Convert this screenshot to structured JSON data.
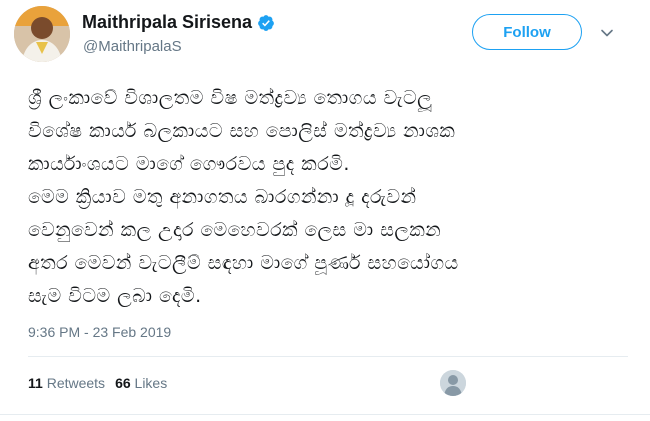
{
  "author": {
    "name": "Maithripala Sirisena",
    "handle": "@MaithripalaS",
    "verified_icon": "verified-badge-icon",
    "avatar_icon": "profile-photo"
  },
  "actions": {
    "follow_label": "Follow",
    "menu_icon": "chevron-down-icon"
  },
  "tweet": {
    "lines": [
      "ශ්‍රී ලංකාවේ විශාලතම විෂ මත්ද්‍රව්‍ය තොගය වැටලූ",
      "විශේෂ කාර්ය බලකායට සහ පොලිස් මත්ද්‍රව්‍ය නාශක",
      "කාර්යාංශයට මාගේ ගෞරවය පුද කරමි.",
      "මෙම ක්‍රියාව මතු අනාගතය බාරගන්නා දූ දරුවන්",
      "වෙනුවෙන් කල උදාර මෙහෙවරක් ලෙස මා සලකන",
      "අතර මෙවන් වැටලීම් සඳහා මාගේ පූර්ණ සහයෝගය",
      "සැම විටම ලබා දෙමි."
    ],
    "timestamp": "9:36 PM - 23 Feb 2019"
  },
  "stats": {
    "retweets_count": "11",
    "retweets_label": "Retweets",
    "likes_count": "66",
    "likes_label": "Likes"
  },
  "colors": {
    "accent": "#1da1f2",
    "text": "#14171a",
    "muted": "#657786",
    "divider": "#e6ecf0"
  }
}
